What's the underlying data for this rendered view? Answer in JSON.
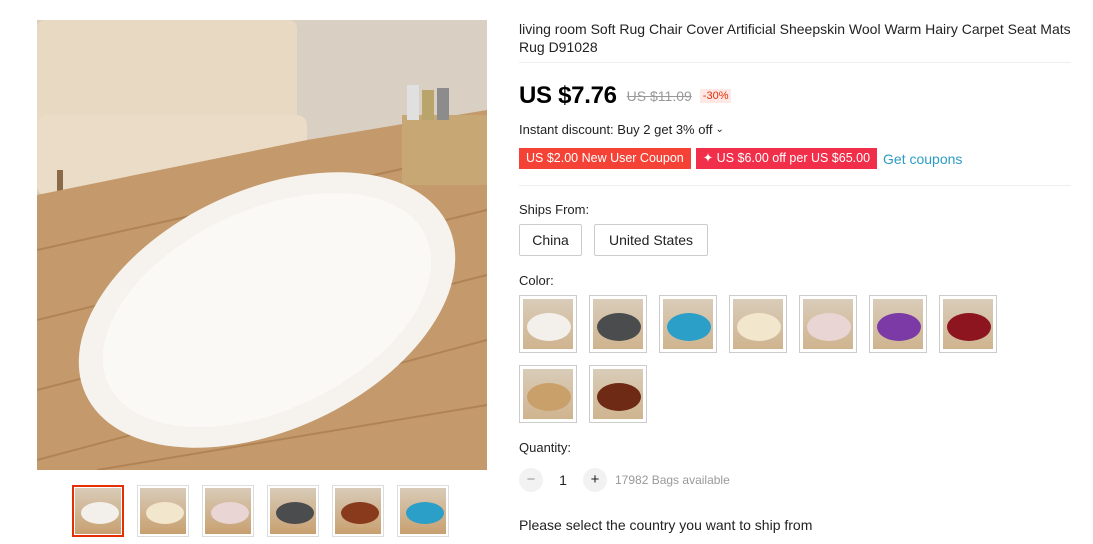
{
  "product": {
    "title": "living room Soft Rug Chair Cover Artificial Sheepskin Wool Warm Hairy Carpet Seat Mats Rug D91028"
  },
  "pricing": {
    "price": "US $7.76",
    "old_price": "US $11.09",
    "discount": "-30%"
  },
  "instant_discount": {
    "label": "Instant discount: Buy 2 get 3% off",
    "icon": "chevron-down-icon"
  },
  "coupons": {
    "new_user": "US $2.00 New User Coupon",
    "store": "✦ US $6.00 off per US $65.00",
    "get_label": "Get coupons"
  },
  "ships_from": {
    "label": "Ships From:",
    "options": [
      "China",
      "United States"
    ]
  },
  "color": {
    "label": "Color:",
    "options": [
      {
        "name": "white",
        "color": "#f3f0ec"
      },
      {
        "name": "dark grey",
        "color": "#4a4c4e"
      },
      {
        "name": "blue",
        "color": "#2b9fc7"
      },
      {
        "name": "beige",
        "color": "#f2e6cc"
      },
      {
        "name": "pink",
        "color": "#e9d5d3"
      },
      {
        "name": "purple",
        "color": "#7b3aa6"
      },
      {
        "name": "red",
        "color": "#8c1520"
      },
      {
        "name": "camel",
        "color": "#c9a06a"
      },
      {
        "name": "brown",
        "color": "#6e2a14"
      }
    ]
  },
  "quantity": {
    "label": "Quantity:",
    "value": "1",
    "minus": "−",
    "plus": "+",
    "available": "17982 Bags available"
  },
  "shipping_note": "Please select the country you want to ship from",
  "gallery": {
    "thumbs": [
      {
        "color": "#f3f0ec",
        "active": true
      },
      {
        "color": "#f2e6cc",
        "active": false
      },
      {
        "color": "#e9d5d3",
        "active": false
      },
      {
        "color": "#4a4c4e",
        "active": false
      },
      {
        "color": "#8a3a1c",
        "active": false
      },
      {
        "color": "#2b9fc7",
        "active": false
      }
    ]
  },
  "colors": {
    "accent": "#e62e04",
    "coupon_bg": "#f44336",
    "link": "#2e9cc3"
  }
}
